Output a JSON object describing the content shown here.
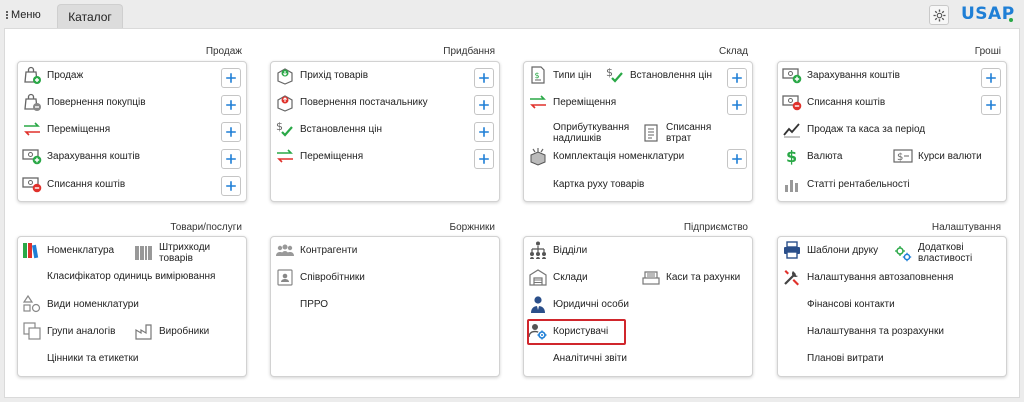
{
  "topbar": {
    "menu_label": "Меню",
    "tab_label": "Каталог",
    "logo": "USAP"
  },
  "colors": {
    "accent": "#1f7fd6",
    "green": "#2aa847",
    "red": "#e0312b",
    "highlight": "#d0262c"
  },
  "sections": {
    "sales": {
      "title": "Продаж",
      "items": [
        "Продаж",
        "Повернення покупців",
        "Переміщення",
        "Зарахування коштів",
        "Списання коштів"
      ]
    },
    "purchases": {
      "title": "Придбання",
      "items": [
        "Прихід товарів",
        "Повернення постачальнику",
        "Встановлення цін",
        "Переміщення"
      ]
    },
    "warehouse": {
      "title": "Склад",
      "items": [
        "Типи цін",
        "Встановлення цін",
        "Переміщення",
        "Оприбуткування надлишків",
        "Списання втрат",
        "Комплектація номенклатури",
        "Картка руху товарів"
      ]
    },
    "money": {
      "title": "Гроші",
      "items": [
        "Зарахування коштів",
        "Списання коштів",
        "Продаж та каса за період",
        "Валюта",
        "Курси валюти",
        "Статті рентабельності"
      ]
    },
    "goods": {
      "title": "Товари/послуги",
      "items": [
        "Номенклатура",
        "Штрихкоди товарів",
        "Класифікатор одиниць вимірювання",
        "Види номенклатури",
        "Групи аналогів",
        "Виробники",
        "Цінники та етикетки"
      ]
    },
    "debtors": {
      "title": "Боржники",
      "items": [
        "Контрагенти",
        "Співробітники",
        "ПРРО"
      ]
    },
    "enterprise": {
      "title": "Підприємство",
      "items": [
        "Відділи",
        "Склади",
        "Каси та рахунки",
        "Юридичні особи",
        "Користувачі",
        "Аналітичні звіти"
      ]
    },
    "settings": {
      "title": "Налаштування",
      "items": [
        "Шаблони друку",
        "Додаткові властивості",
        "Налаштування автозаповнення",
        "Фінансові контакти",
        "Налаштування та розрахунки",
        "Планові витрати"
      ]
    }
  }
}
